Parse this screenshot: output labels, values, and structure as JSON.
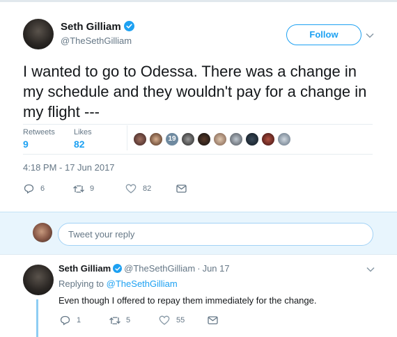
{
  "tweet": {
    "name": "Seth Gilliam",
    "handle": "@TheSethGilliam",
    "follow_label": "Follow",
    "text": "I wanted to go to Odessa. There was a change in my schedule and they wouldn't pay for a change in my flight ---",
    "retweets_label": "Retweets",
    "retweets": "9",
    "likes_label": "Likes",
    "likes": "82",
    "timestamp": "4:18 PM - 17 Jun 2017",
    "actions": {
      "replies": "6",
      "retweets": "9",
      "likes": "82"
    },
    "liker_count": 10,
    "likers_numeral_badge": "19"
  },
  "reply_box": {
    "placeholder": "Tweet your reply"
  },
  "reply": {
    "name": "Seth Gilliam",
    "handle": "@TheSethGilliam",
    "separator": "·",
    "date": "Jun 17",
    "replying_prefix": "Replying to",
    "replying_to": "@TheSethGilliam",
    "text": "Even though I offered to repay them immediately for the change.",
    "actions": {
      "replies": "1",
      "retweets": "5",
      "likes": "55"
    }
  },
  "colors": {
    "accent": "#1da1f2",
    "text": "#14171a",
    "muted": "#657786",
    "reply_bg": "#e8f5fd",
    "like_icon": "#8899a6"
  },
  "icons": [
    "verified-badge-icon",
    "chevron-down-icon",
    "reply-icon",
    "retweet-icon",
    "heart-icon",
    "message-icon"
  ]
}
